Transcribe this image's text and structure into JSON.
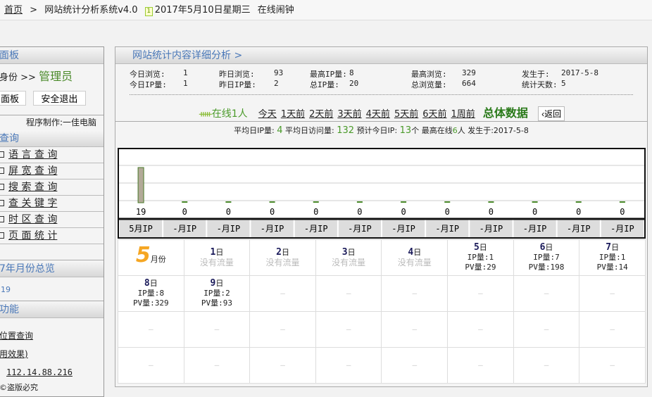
{
  "topbar": {
    "home": "首页",
    "sep": ">",
    "title": "网站统计分析系统v4.0",
    "cal_icon": "1",
    "date": "2017年5月10日星期三",
    "alarm": "在线闹钟"
  },
  "left": {
    "panel_header": "面板",
    "identity_label": "身份 >>",
    "identity_value": "管理员",
    "btn_panel": "面板",
    "btn_logout": "安全退出",
    "credit": "程序制作:一佳电脑",
    "query_header": "查询",
    "query_items": [
      "语 言 查 询",
      "屏 宽 查 询",
      "搜 索 查 询",
      "查 关 键 字",
      "时 区 查 询",
      "页 面 统 计"
    ],
    "month_header": "7年月份总览",
    "month_link": "19",
    "func_header": "功能",
    "func_links": [
      "位置查询",
      "用效果)",
      "112.14.88.216"
    ],
    "copyright": "©盗版必究"
  },
  "main": {
    "header": "网站统计内容详细分析 >",
    "stats": [
      [
        "今日浏览:",
        "1"
      ],
      [
        "昨日浏览:",
        "93"
      ],
      [
        "最高IP量:",
        "8"
      ],
      [
        "最高浏览:",
        "329"
      ],
      [
        "发生于:",
        "2017-5-8"
      ],
      [
        "今日IP量:",
        "1"
      ],
      [
        "昨日IP量:",
        "2"
      ],
      [
        "总IP量:",
        "20"
      ],
      [
        "总浏览量:",
        "664"
      ],
      [
        "统计天数:",
        "5"
      ]
    ],
    "online": "在线1人",
    "days": [
      "今天",
      "1天前",
      "2天前",
      "3天前",
      "4天前",
      "5天前",
      "6天前",
      "1周前"
    ],
    "total": "总体数据",
    "back": "‹返回",
    "avg": {
      "l1": "平均日IP量:",
      "v1": "4",
      "l2": "平均日访问量:",
      "v2": "132",
      "l3": "预计今日IP:",
      "v3": "13",
      "l3b": "个",
      "l4": "最高在线",
      "v4": "6",
      "l4b": "人",
      "l5": "发生于:2017-5-8"
    }
  },
  "chart_data": {
    "type": "bar",
    "categories": [
      "5月IP",
      "-月IP",
      "-月IP",
      "-月IP",
      "-月IP",
      "-月IP",
      "-月IP",
      "-月IP",
      "-月IP",
      "-月IP",
      "-月IP",
      "-月IP"
    ],
    "values": [
      19,
      0,
      0,
      0,
      0,
      0,
      0,
      0,
      0,
      0,
      0,
      0
    ],
    "ylim": [
      0,
      19
    ]
  },
  "calendar": {
    "month": "5",
    "month_suffix": "月份",
    "no_traffic": "没有流量",
    "dash": "—",
    "day_suffix": "日",
    "ip_label": "IP量:",
    "pv_label": "PV量:",
    "days": [
      {
        "d": "1"
      },
      {
        "d": "2"
      },
      {
        "d": "3"
      },
      {
        "d": "4"
      },
      {
        "d": "5",
        "ip": "1",
        "pv": "29"
      },
      {
        "d": "6",
        "ip": "7",
        "pv": "198"
      },
      {
        "d": "7",
        "ip": "1",
        "pv": "14"
      },
      {
        "d": "8",
        "ip": "8",
        "pv": "329"
      },
      {
        "d": "9",
        "ip": "2",
        "pv": "93"
      }
    ]
  }
}
